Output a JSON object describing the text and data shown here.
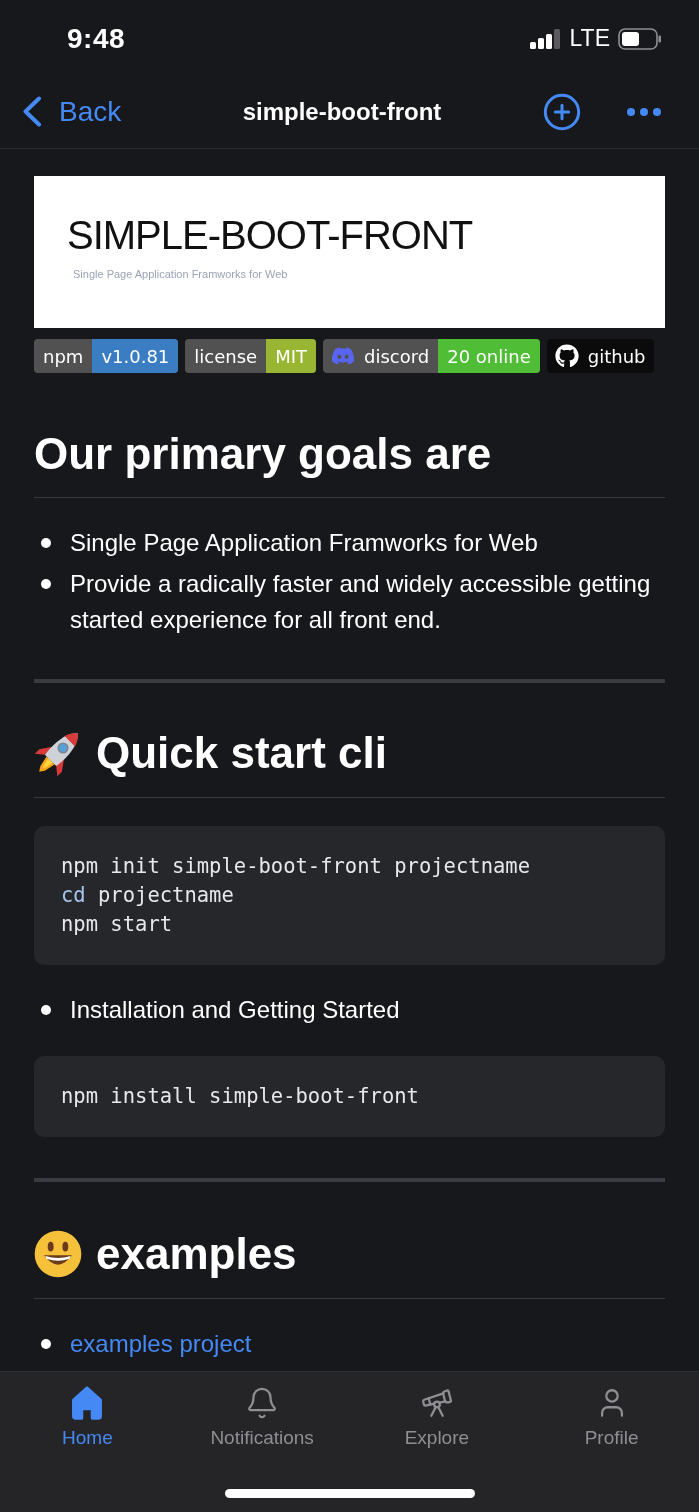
{
  "status_bar": {
    "time": "9:48",
    "network": "LTE"
  },
  "nav_bar": {
    "back": "Back",
    "title": "simple-boot-front"
  },
  "readme": {
    "banner": {
      "title": "SIMPLE-BOOT-FRONT",
      "subtitle": "Single Page Application Framworks for Web"
    },
    "badges": [
      {
        "kind": "split",
        "label": "npm",
        "value": "v1.0.81",
        "color": "#3a7dc2"
      },
      {
        "kind": "split",
        "label": "license",
        "value": "MIT",
        "color": "#99b633"
      },
      {
        "kind": "chat",
        "label": "discord",
        "value": "20 online",
        "color": "#4fbd36"
      },
      {
        "kind": "repo",
        "label": "github"
      }
    ],
    "goals": {
      "heading": "Our primary goals are",
      "items": [
        "Single Page Application Framworks for Web",
        "Provide a radically faster and widely accessible getting started experience for all front end."
      ]
    },
    "quick_start": {
      "heading": "Quick start cli",
      "code": [
        [
          {
            "kind": "plain",
            "text": "npm init simple-boot-front projectname"
          }
        ],
        [
          {
            "kind": "builtin",
            "text": "cd"
          },
          {
            "kind": "plain",
            "text": "projectname"
          }
        ],
        [
          {
            "kind": "plain",
            "text": "npm start"
          }
        ]
      ],
      "note": "Installation and Getting Started",
      "install_code": [
        [
          {
            "kind": "plain",
            "text": "npm install simple-boot-front"
          }
        ]
      ]
    },
    "examples": {
      "heading": "examples",
      "links": [
        "examples project"
      ]
    }
  },
  "tab_bar": {
    "tabs": [
      {
        "kind": "home",
        "label": "Home",
        "selected": true
      },
      {
        "kind": "notifications",
        "label": "Notifications",
        "selected": false
      },
      {
        "kind": "explore",
        "label": "Explore",
        "selected": false
      },
      {
        "kind": "profile",
        "label": "Profile",
        "selected": false
      }
    ]
  }
}
